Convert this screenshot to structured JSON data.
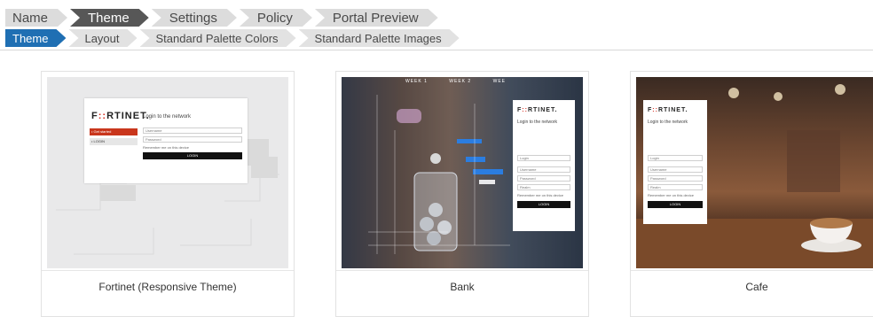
{
  "breadcrumb_primary": {
    "items": [
      {
        "label": "Name",
        "active": false
      },
      {
        "label": "Theme",
        "active": true
      },
      {
        "label": "Settings",
        "active": false
      },
      {
        "label": "Policy",
        "active": false
      },
      {
        "label": "Portal Preview",
        "active": false
      }
    ]
  },
  "breadcrumb_secondary": {
    "items": [
      {
        "label": "Theme",
        "active": true
      },
      {
        "label": "Layout",
        "active": false
      },
      {
        "label": "Standard Palette Colors",
        "active": false
      },
      {
        "label": "Standard Palette Images",
        "active": false
      }
    ]
  },
  "colors": {
    "active_primary": "#575757",
    "active_secondary": "#1f6fb3",
    "brand_red": "#d62b1f"
  },
  "themes": [
    {
      "caption": "Fortinet (Responsive Theme)",
      "preview": {
        "logo_pre": "F",
        "logo_mark": "::",
        "logo_post": "RTINET.",
        "login_title": "Login to the network",
        "menu": [
          "• Get started",
          "• LOGIN"
        ],
        "fields": [
          "Username",
          "Password"
        ],
        "remember": "Remember me on this device",
        "button": "LOGIN"
      }
    },
    {
      "caption": "Bank",
      "preview": {
        "logo_pre": "F",
        "logo_mark": "::",
        "logo_post": "RTINET.",
        "login_title": "Login to the network",
        "weeks": [
          "WEEK 1",
          "WEEK 2",
          "WEE"
        ],
        "fields": [
          "Login",
          "Username",
          "Password",
          "Realm"
        ],
        "remember": "Remember me on this device",
        "button": "LOGIN"
      }
    },
    {
      "caption": "Cafe",
      "preview": {
        "logo_pre": "F",
        "logo_mark": "::",
        "logo_post": "RTINET.",
        "login_title": "Login to the network",
        "fields": [
          "Login",
          "Username",
          "Password",
          "Realm"
        ],
        "remember": "Remember me on this device",
        "button": "LOGIN"
      }
    }
  ]
}
